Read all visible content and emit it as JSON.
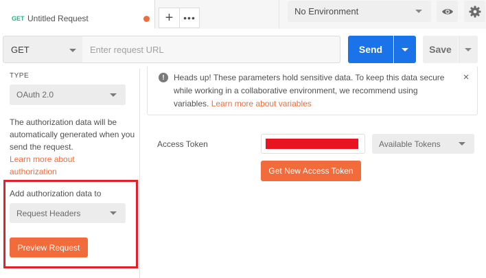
{
  "tab": {
    "method": "GET",
    "title": "Untitled Request",
    "unsaved_dot_color": "#f26b3a"
  },
  "tab_actions": {
    "new_tab_label": "+",
    "more_label": "•••"
  },
  "environment": {
    "selected": "No Environment",
    "eye_icon": "eye-icon",
    "settings_icon": "gear-icon"
  },
  "request": {
    "method": "GET",
    "url_placeholder": "Enter request URL",
    "url_value": "",
    "send_label": "Send",
    "save_label": "Save"
  },
  "auth": {
    "type_label": "TYPE",
    "type_selected": "OAuth 2.0",
    "description": "The authorization data will be automatically generated when you send the request.",
    "learn_more": "Learn more about authorization",
    "add_to_label": "Add authorization data to",
    "add_to_selected": "Request Headers",
    "preview_label": "Preview Request"
  },
  "notice": {
    "icon": "info-icon",
    "text": "Heads up! These parameters hold sensitive data. To keep this data secure while working in a collaborative environment, we recommend using variables. ",
    "link": "Learn more about variables",
    "close_label": "×"
  },
  "token": {
    "label": "Access Token",
    "available_tokens": "Available Tokens",
    "get_new_label": "Get New Access Token"
  },
  "colors": {
    "accent_orange": "#f26b3a",
    "send_blue": "#1a73e8",
    "highlight_red": "#e0202a",
    "method_green": "#26b47f"
  }
}
